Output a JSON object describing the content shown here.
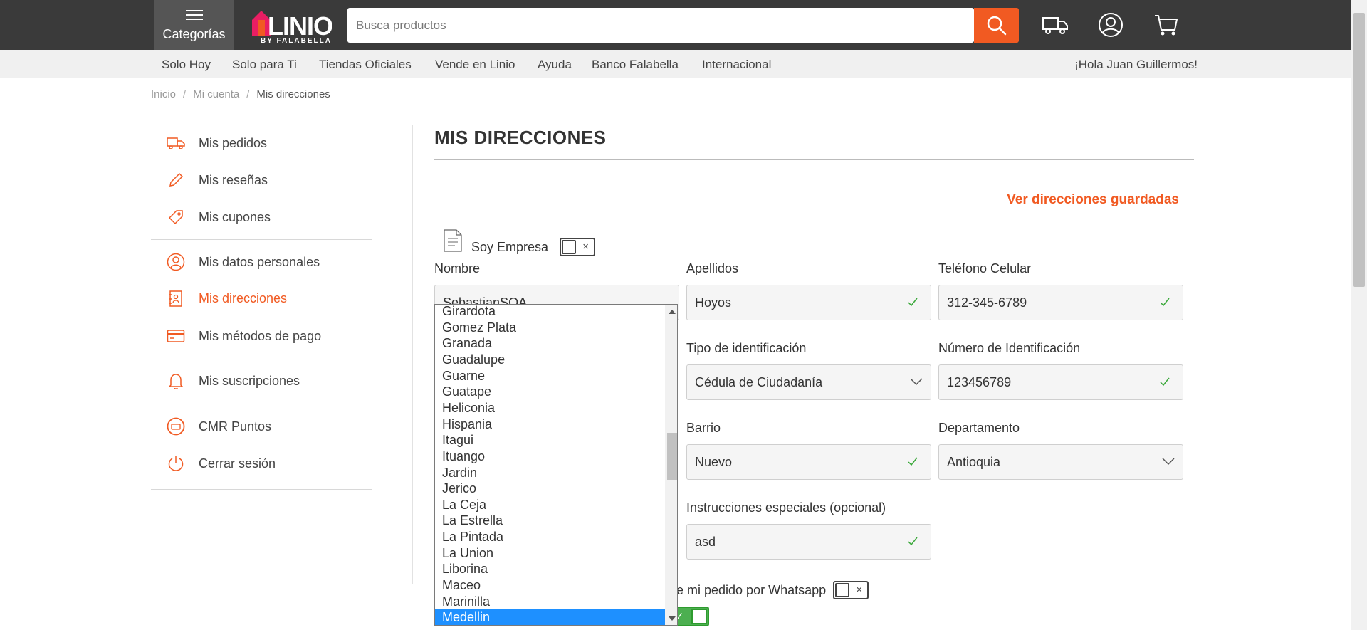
{
  "header": {
    "categories_label": "Categorías",
    "logo_text": "LINIO",
    "logo_subtext": "BY FALABELLA",
    "search_placeholder": "Busca productos"
  },
  "nav": {
    "links": [
      "Solo Hoy",
      "Solo para Ti",
      "Tiendas Oficiales",
      "Vende en Linio",
      "Ayuda",
      "Banco Falabella",
      "Internacional"
    ],
    "greeting": "¡Hola Juan Guillermos!"
  },
  "breadcrumb": [
    "Inicio",
    "Mi cuenta",
    "Mis direcciones"
  ],
  "sidebar": {
    "items": [
      {
        "label": "Mis pedidos",
        "icon": "truck-icon"
      },
      {
        "label": "Mis reseñas",
        "icon": "pencil-icon"
      },
      {
        "label": "Mis cupones",
        "icon": "tag-icon"
      },
      {
        "label": "Mis datos personales",
        "icon": "user-icon"
      },
      {
        "label": "Mis direcciones",
        "icon": "address-book-icon"
      },
      {
        "label": "Mis métodos de pago",
        "icon": "card-icon"
      },
      {
        "label": "Mis suscripciones",
        "icon": "bell-icon"
      },
      {
        "label": "CMR Puntos",
        "icon": "cmr-icon"
      },
      {
        "label": "Cerrar sesión",
        "icon": "power-icon"
      }
    ],
    "active_label": "Mis direcciones",
    "accent_color": "#f15a22"
  },
  "main": {
    "title": "MIS DIRECCIONES",
    "saved_link": "Ver direcciones guardadas",
    "empresa_label": "Soy Empresa",
    "fields": {
      "nombre": {
        "label": "Nombre",
        "value": "SebastianSOA"
      },
      "apellidos": {
        "label": "Apellidos",
        "value": "Hoyos"
      },
      "telefono": {
        "label": "Teléfono Celular",
        "value": "312-345-6789"
      },
      "tipo_id": {
        "label": "Tipo de identificación",
        "value": "Cédula de Ciudadanía"
      },
      "numero_id": {
        "label": "Número de Identificación",
        "value": "123456789"
      },
      "barrio": {
        "label": "Barrio",
        "value": "Nuevo"
      },
      "departamento": {
        "label": "Departamento",
        "value": "Antioquia"
      },
      "instrucciones": {
        "label": "Instrucciones especiales (opcional)",
        "value": "asd"
      }
    },
    "whatsapp_label": "e mi pedido por Whatsapp"
  },
  "city_dropdown": {
    "options": [
      "Girardota",
      "Gomez Plata",
      "Granada",
      "Guadalupe",
      "Guarne",
      "Guatape",
      "Heliconia",
      "Hispania",
      "Itagui",
      "Ituango",
      "Jardin",
      "Jerico",
      "La Ceja",
      "La Estrella",
      "La Pintada",
      "La Union",
      "Liborina",
      "Maceo",
      "Marinilla",
      "Medellin"
    ],
    "selected": "Medellin",
    "highlight_color": "#1e90ff"
  }
}
